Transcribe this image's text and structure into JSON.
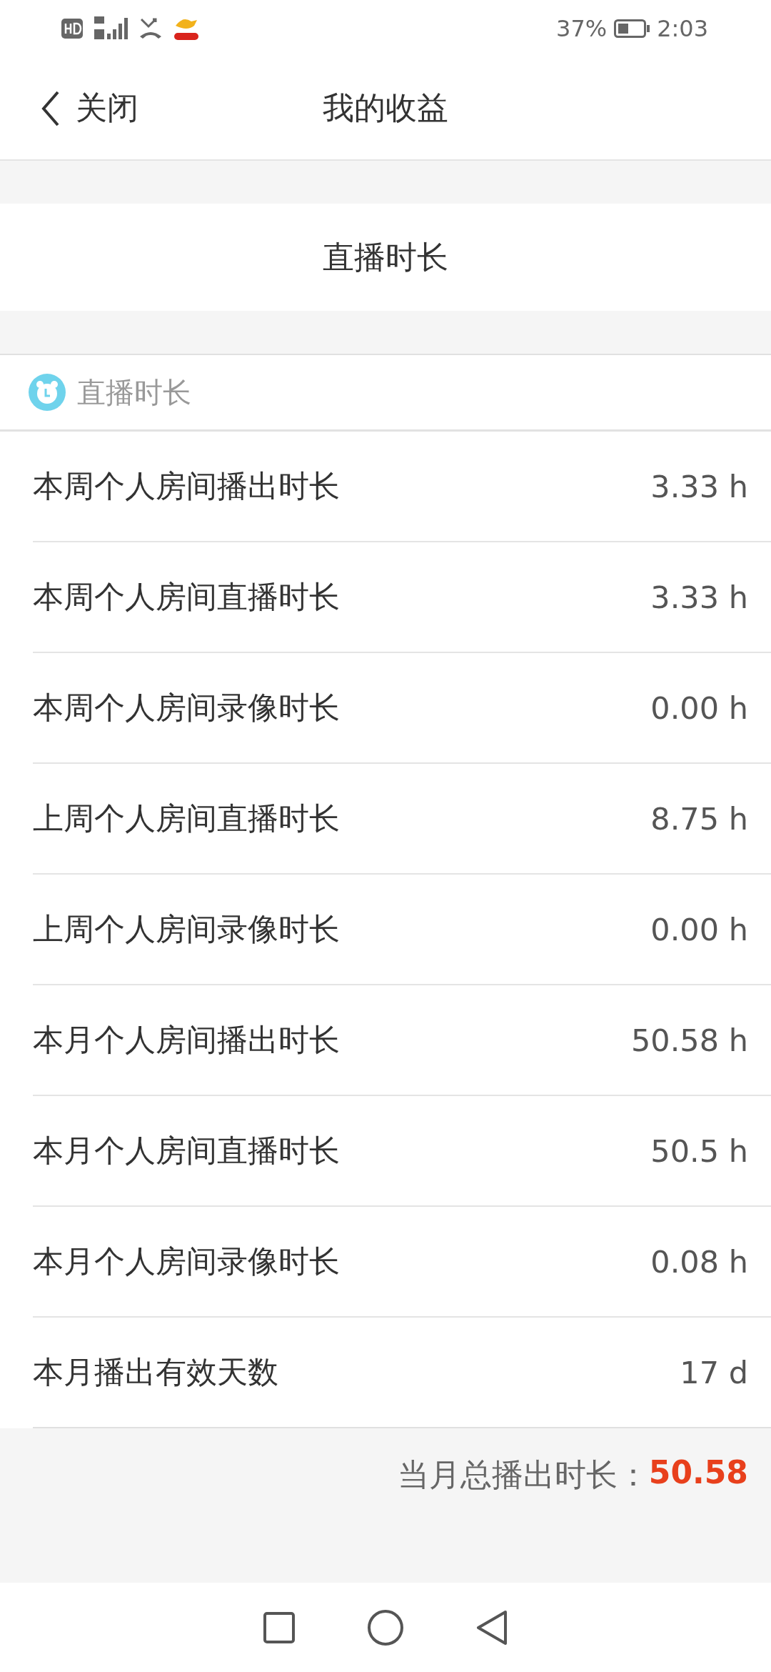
{
  "status_bar": {
    "battery": "37%",
    "time": "2:03"
  },
  "header": {
    "back_label": "关闭",
    "title": "我的收益"
  },
  "banner": {
    "title": "直播时长"
  },
  "section": {
    "title": "直播时长"
  },
  "rows": [
    {
      "label": "本周个人房间播出时长",
      "value": "3.33 h"
    },
    {
      "label": "本周个人房间直播时长",
      "value": "3.33 h"
    },
    {
      "label": "本周个人房间录像时长",
      "value": "0.00 h"
    },
    {
      "label": "上周个人房间直播时长",
      "value": "8.75 h"
    },
    {
      "label": "上周个人房间录像时长",
      "value": "0.00 h"
    },
    {
      "label": "本月个人房间播出时长",
      "value": "50.58 h"
    },
    {
      "label": "本月个人房间直播时长",
      "value": "50.5 h"
    },
    {
      "label": "本月个人房间录像时长",
      "value": "0.08 h"
    },
    {
      "label": "本月播出有效天数",
      "value": "17 d"
    }
  ],
  "total": {
    "label": "当月总播出时长：",
    "value": "50.58"
  }
}
